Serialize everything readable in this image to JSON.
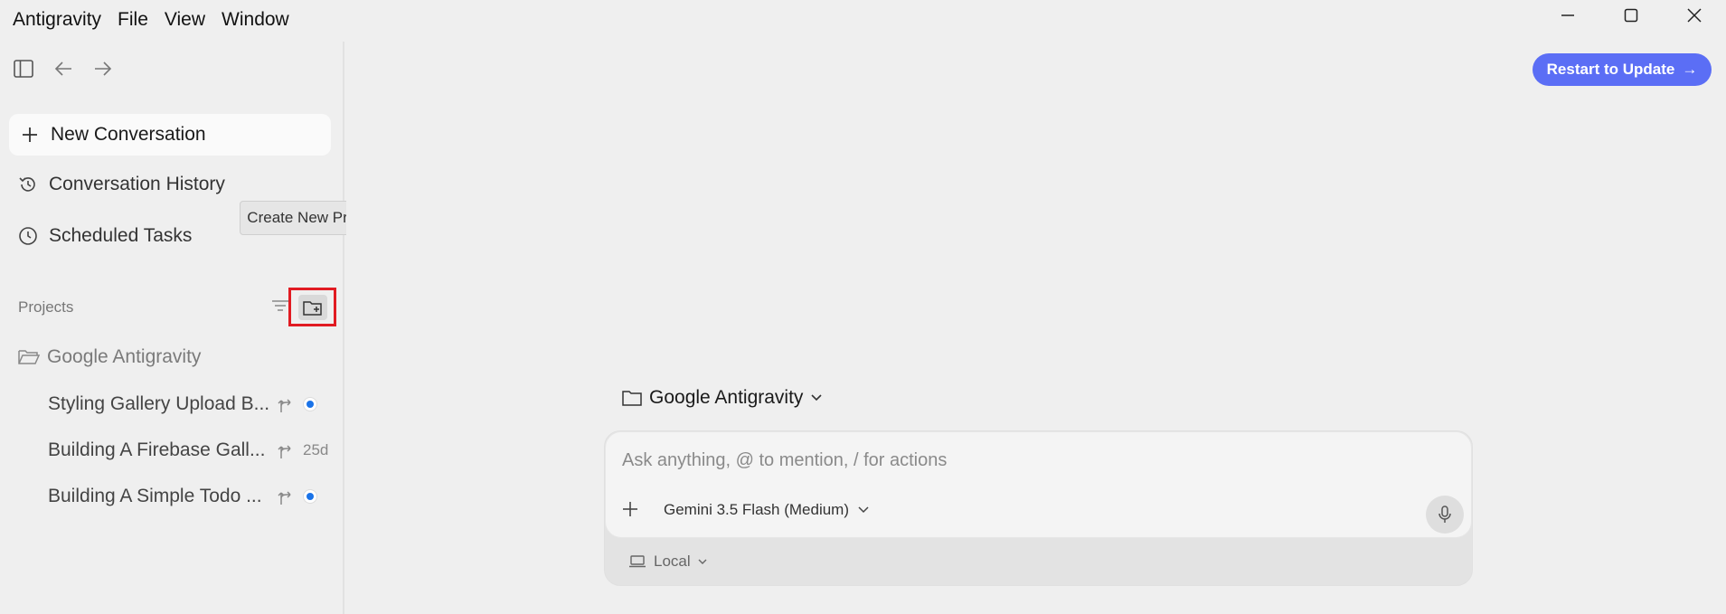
{
  "menu": {
    "app": "Antigravity",
    "file": "File",
    "view": "View",
    "window": "Window"
  },
  "sidebar": {
    "new_conversation": "New Conversation",
    "conversation_history": "Conversation History",
    "scheduled_tasks": "Scheduled Tasks",
    "projects_label": "Projects",
    "tooltip": "Create New Project",
    "project_name": "Google Antigravity",
    "conversations": [
      {
        "title": "Styling Gallery Upload B...",
        "meta": ""
      },
      {
        "title": "Building A Firebase Gall...",
        "meta": "25d"
      },
      {
        "title": "Building A Simple Todo ...",
        "meta": ""
      }
    ]
  },
  "main": {
    "restart_button": "Restart to Update",
    "restart_arrow": "→",
    "workspace": "Google Antigravity",
    "input_placeholder": "Ask anything, @ to mention, / for actions",
    "model": "Gemini 3.5 Flash (Medium)",
    "location": "Local"
  },
  "colors": {
    "accent": "#5b6ef5",
    "highlight_border": "#e11b22",
    "status_dot": "#1a73e8"
  }
}
